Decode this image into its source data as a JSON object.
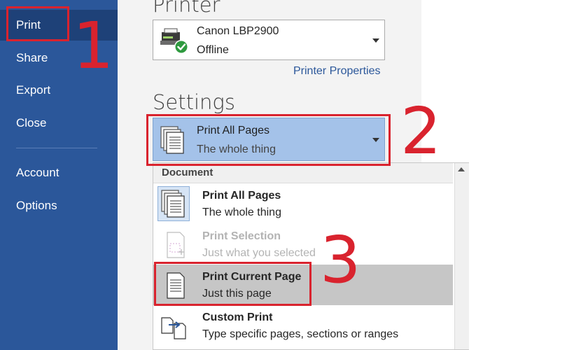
{
  "nav": {
    "items": [
      {
        "label": "Print",
        "selected": true
      },
      {
        "label": "Share"
      },
      {
        "label": "Export"
      },
      {
        "label": "Close"
      },
      {
        "label": "Account"
      },
      {
        "label": "Options"
      }
    ]
  },
  "printer": {
    "heading": "Printer",
    "name": "Canon LBP2900",
    "status": "Offline",
    "properties_link": "Printer Properties"
  },
  "settings": {
    "heading": "Settings",
    "selected_title": "Print All Pages",
    "selected_sub": "The whole thing"
  },
  "menu": {
    "section": "Document",
    "items": [
      {
        "title": "Print All Pages",
        "sub": "The whole thing"
      },
      {
        "title": "Print Selection",
        "sub": "Just what you selected",
        "disabled": true
      },
      {
        "title": "Print Current Page",
        "sub": "Just this page",
        "highlighted": true
      },
      {
        "title": "Custom Print",
        "sub": "Type specific pages, sections or ranges"
      }
    ]
  },
  "annotations": {
    "step1": "1",
    "step2": "2",
    "step3": "3"
  },
  "colors": {
    "nav_bg": "#2b579a",
    "selection_bg": "#a4c2e9",
    "annotation_red": "#d9232e"
  }
}
